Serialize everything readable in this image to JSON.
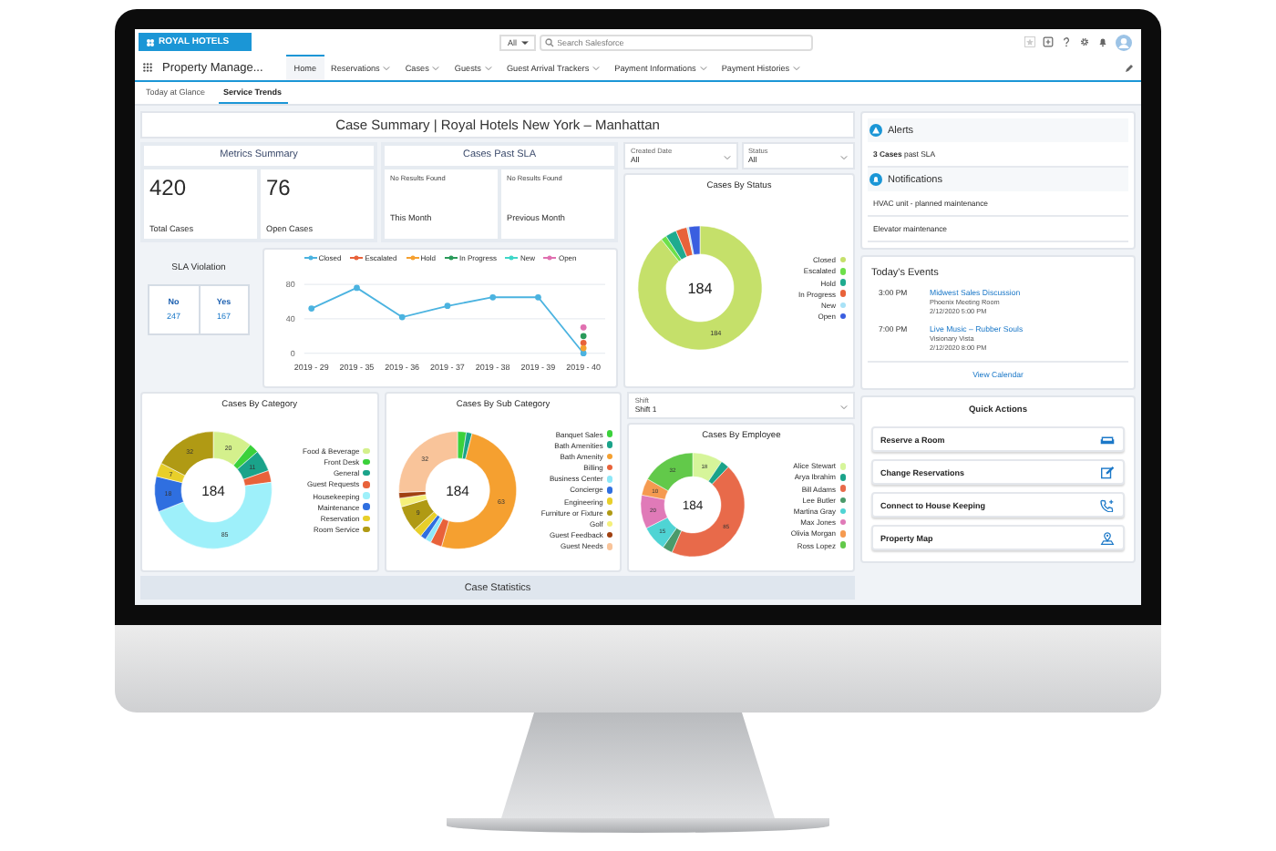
{
  "header": {
    "logo": "ROYAL HOTELS",
    "search_scope": "All",
    "search_placeholder": "Search Salesforce"
  },
  "nav": {
    "app_name": "Property Manage...",
    "tabs": [
      {
        "label": "Home",
        "selected": true,
        "menu": false
      },
      {
        "label": "Reservations",
        "selected": false,
        "menu": true
      },
      {
        "label": "Cases",
        "selected": false,
        "menu": true
      },
      {
        "label": "Guests",
        "selected": false,
        "menu": true
      },
      {
        "label": "Guest Arrival Trackers",
        "selected": false,
        "menu": true
      },
      {
        "label": "Payment Informations",
        "selected": false,
        "menu": true
      },
      {
        "label": "Payment Histories",
        "selected": false,
        "menu": true
      }
    ]
  },
  "subtabs": [
    {
      "label": "Today at Glance",
      "selected": false
    },
    {
      "label": "Service Trends",
      "selected": true
    }
  ],
  "dashboard": {
    "title": "Case Summary | Royal Hotels New York – Manhattan",
    "metrics_summary": {
      "title": "Metrics Summary",
      "items": [
        {
          "value": "420",
          "label": "Total Cases"
        },
        {
          "value": "76",
          "label": "Open Cases"
        }
      ]
    },
    "cases_past_sla": {
      "title": "Cases Past SLA",
      "items": [
        {
          "note": "No Results Found",
          "label": "This Month"
        },
        {
          "note": "No Results Found",
          "label": "Previous Month"
        }
      ]
    },
    "sla_violation": {
      "title": "SLA Violation",
      "items": [
        {
          "label": "No",
          "value": "247"
        },
        {
          "label": "Yes",
          "value": "167"
        }
      ]
    },
    "trend": {
      "chart_data": {
        "type": "line",
        "x": [
          "2019 - 29",
          "2019 - 35",
          "2019 - 36",
          "2019 - 37",
          "2019 - 38",
          "2019 - 39",
          "2019 - 40"
        ],
        "ylim": [
          0,
          80
        ],
        "yticks": [
          0,
          40,
          80
        ],
        "series": [
          {
            "name": "Closed",
            "color": "#4bb3e0",
            "marker": "circle",
            "values": [
              52,
              76,
              42,
              55,
              65,
              65,
              0
            ]
          },
          {
            "name": "Escalated",
            "color": "#e8623a",
            "marker": "circle",
            "values": [
              null,
              null,
              null,
              null,
              null,
              null,
              12
            ]
          },
          {
            "name": "Hold",
            "color": "#f5a030",
            "marker": "circle",
            "values": [
              null,
              null,
              null,
              null,
              null,
              null,
              6
            ]
          },
          {
            "name": "In Progress",
            "color": "#2a9a5a",
            "marker": "circle",
            "values": [
              null,
              null,
              null,
              null,
              null,
              null,
              20
            ]
          },
          {
            "name": "New",
            "color": "#3fd6c8",
            "marker": "circle",
            "values": [
              null,
              null,
              null,
              null,
              null,
              null,
              null
            ]
          },
          {
            "name": "Open",
            "color": "#e070b0",
            "marker": "circle",
            "values": [
              null,
              null,
              null,
              null,
              null,
              null,
              30
            ]
          }
        ]
      }
    },
    "filters": [
      {
        "label": "Created Date",
        "value": "All"
      },
      {
        "label": "Status",
        "value": "All"
      }
    ],
    "cases_by_status": {
      "total": "184",
      "chart_data": {
        "type": "donut",
        "title": "Cases By Status",
        "value_labels": [
          "184",
          null,
          null,
          null,
          null,
          null
        ],
        "categories": [
          "Closed",
          "Escalated",
          "Hold",
          "In Progress",
          "New",
          "Open"
        ],
        "values": [
          184,
          3,
          6,
          6,
          1,
          6
        ],
        "colors": [
          "#c5e06a",
          "#6de04a",
          "#1fab8f",
          "#e8623a",
          "#a8e2f7",
          "#3a5ee0"
        ]
      }
    },
    "cases_by_category": {
      "total": "184",
      "chart_data": {
        "type": "donut",
        "title": "Cases By Category",
        "value_labels": [
          "20",
          null,
          "11",
          null,
          "85",
          "18",
          "7",
          "32"
        ],
        "categories": [
          "Food & Beverage",
          "Front Desk",
          "General",
          "Guest Requests",
          "Housekeeping",
          "Maintenance",
          "Reservation",
          "Room Service"
        ],
        "values": [
          20,
          5,
          11,
          6,
          85,
          18,
          7,
          32
        ],
        "colors": [
          "#d4f08c",
          "#3bd13b",
          "#1aa38a",
          "#e8623a",
          "#9ef0fa",
          "#2f6fe0",
          "#e8cf2a",
          "#b09a14"
        ]
      }
    },
    "cases_by_sub_category": {
      "total": "184",
      "chart_data": {
        "type": "donut",
        "title": "Cases By Sub Category",
        "value_labels": [
          null,
          null,
          "63",
          null,
          null,
          null,
          null,
          "9",
          null,
          null,
          "32"
        ],
        "categories": [
          "Banquet Sales",
          "Bath Amenities",
          "Bath Amenity",
          "Billing",
          "Business Center",
          "Concierge",
          "Engineering",
          "Furniture or Fixture",
          "Golf",
          "Guest Feedback",
          "Guest Needs"
        ],
        "values": [
          3,
          2,
          63,
          4,
          2,
          2,
          3,
          9,
          3,
          2,
          32
        ],
        "colors": [
          "#3bd13b",
          "#1aa38a",
          "#f5a030",
          "#e8623a",
          "#8ee8f8",
          "#2f6fe0",
          "#e8cf2a",
          "#b09a14",
          "#f5f07a",
          "#a04010",
          "#f9c49a"
        ]
      }
    },
    "shift_filter": {
      "label": "Shift",
      "value": "Shift 1"
    },
    "cases_by_employee": {
      "total": "184",
      "chart_data": {
        "type": "donut",
        "title": "Cases By Employee",
        "value_labels": [
          "18",
          null,
          "85",
          null,
          "15",
          "20",
          "10",
          "32"
        ],
        "categories": [
          "Alice Stewart",
          "Arya Ibrahim",
          "Bill Adams",
          "Lee Butler",
          "Martina Gray",
          "Max Jones",
          "Olivia Morgan",
          "Ross Lopez"
        ],
        "values": [
          18,
          5,
          85,
          6,
          15,
          20,
          10,
          32
        ],
        "colors": [
          "#d6f59a",
          "#1aa38a",
          "#e86a4a",
          "#4a9a6a",
          "#4fd4d4",
          "#e07ab8",
          "#f59a50",
          "#62c94a"
        ]
      }
    },
    "case_statistics": "Case Statistics"
  },
  "sidebar": {
    "alerts": {
      "title": "Alerts",
      "items": [
        "**3 Cases** past SLA"
      ]
    },
    "notifications": {
      "title": "Notifications",
      "items": [
        "HVAC unit - planned maintenance",
        "Elevator maintenance"
      ]
    },
    "events": {
      "title": "Today's Events",
      "items": [
        {
          "time": "3:00 PM",
          "title": "Midwest Sales Discussion",
          "place": "Phoenix Meeting Room",
          "when": "2/12/2020 5:00 PM"
        },
        {
          "time": "7:00 PM",
          "title": "Live Music – Rubber Souls",
          "place": "Visionary Vista",
          "when": "2/12/2020 8:00 PM"
        }
      ],
      "link": "View Calendar"
    },
    "quick_actions": {
      "title": "Quick Actions",
      "items": [
        {
          "label": "Reserve a Room",
          "kind": "sofa"
        },
        {
          "label": "Change Reservations",
          "kind": "edit"
        },
        {
          "label": "Connect to House Keeping",
          "kind": "phone"
        },
        {
          "label": "Property Map",
          "kind": "pin"
        }
      ]
    }
  }
}
